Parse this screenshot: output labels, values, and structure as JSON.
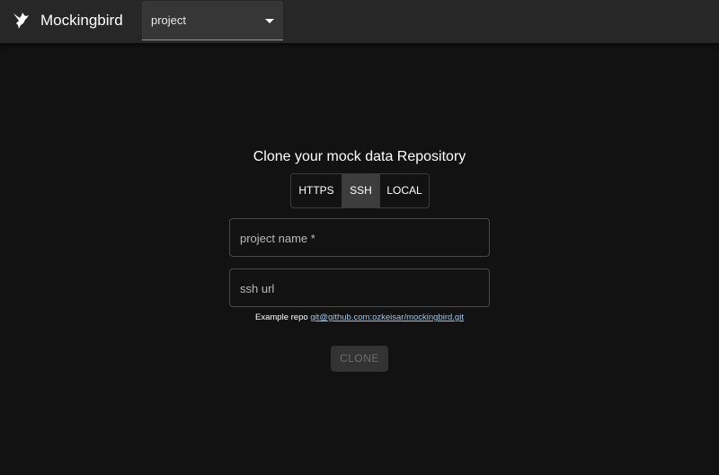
{
  "app": {
    "title": "Mockingbird",
    "logo_icon": "bird-icon"
  },
  "project_select": {
    "value": "project"
  },
  "clone_form": {
    "heading": "Clone your mock data Repository",
    "protocols": [
      {
        "label": "HTTPS",
        "selected": false
      },
      {
        "label": "SSH",
        "selected": true
      },
      {
        "label": "LOCAL",
        "selected": false
      }
    ],
    "project_name_label": "project name *",
    "ssh_url_label": "ssh url",
    "example_prefix": "Example repo",
    "example_link": "git@github.com:ozkeisar/mockingbird.git",
    "clone_label": "CLONE",
    "clone_disabled": true
  },
  "colors": {
    "background": "#121212",
    "appbar": "#272727",
    "link": "#90caf9"
  }
}
